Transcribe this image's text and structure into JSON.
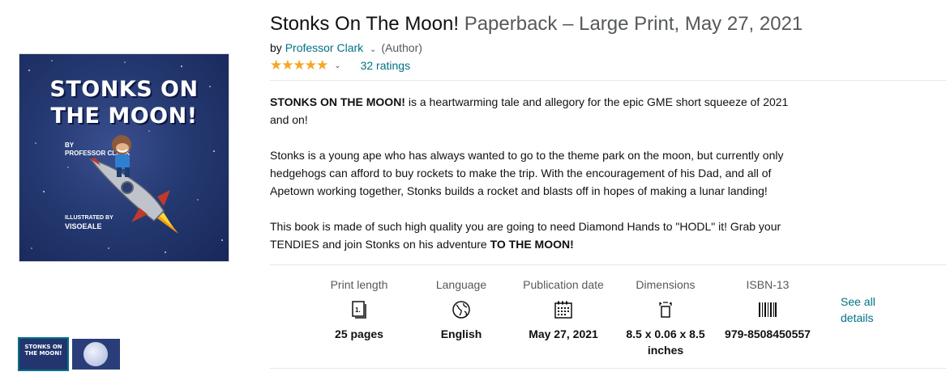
{
  "product": {
    "title": "Stonks On The Moon!",
    "format": "Paperback – Large Print, May 27, 2021",
    "by_prefix": "by",
    "author": "Professor Clark",
    "author_role": "(Author)",
    "rating_stars": "★★★★★",
    "ratings_count": "32 ratings"
  },
  "cover": {
    "title_line1": "STONKS ON",
    "title_line2": "THE MOON!",
    "by_line": "BY",
    "author_line": "PROFESSOR CLARK",
    "illustrated_line": "ILLUSTRATED BY",
    "illustrator": "VISOEALE"
  },
  "thumbnails": {
    "thumb1_text": "STONKS ON THE MOON!"
  },
  "description": {
    "p1_bold": "STONKS ON THE MOON!",
    "p1_rest": " is a heartwarming tale and allegory for the epic GME short squeeze of 2021 and on!",
    "p2": "Stonks is a young ape who has always wanted to go to the theme park on the moon, but currently only hedgehogs can afford to buy rockets to make the trip. With the encouragement of his Dad, and all of Apetown working together, Stonks builds a rocket and blasts off in hopes of making a lunar landing!",
    "p3_start": "This book is made of such high quality you are going to need Diamond Hands to \"HODL\" it! Grab your TENDIES and join Stonks on his adventure ",
    "p3_bold": "TO THE MOON!"
  },
  "details": [
    {
      "label": "Print length",
      "value": "25 pages",
      "icon": "book-pages-icon"
    },
    {
      "label": "Language",
      "value": "English",
      "icon": "globe-icon"
    },
    {
      "label": "Publication date",
      "value": "May 27, 2021",
      "icon": "calendar-icon"
    },
    {
      "label": "Dimensions",
      "value": "8.5 x 0.06 x 8.5 inches",
      "icon": "dimensions-icon"
    },
    {
      "label": "ISBN-13",
      "value": "979-8508450557",
      "icon": "barcode-icon"
    }
  ],
  "see_all_details": "See all details",
  "colors": {
    "link": "#007185",
    "star": "#f5a623",
    "text": "#0f1111",
    "muted": "#565959"
  }
}
